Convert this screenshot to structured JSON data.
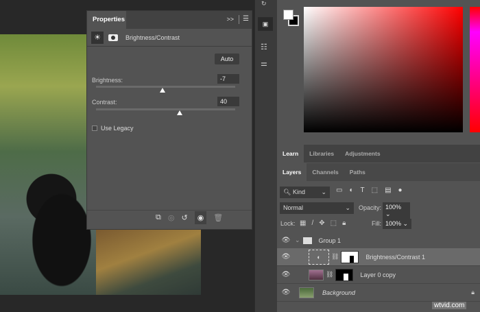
{
  "properties": {
    "tab": "Properties",
    "collapse": ">>",
    "adjustment_name": "Brightness/Contrast",
    "auto_label": "Auto",
    "brightness_label": "Brightness:",
    "brightness_value": "-7",
    "brightness_min": -150,
    "brightness_max": 150,
    "contrast_label": "Contrast:",
    "contrast_value": "40",
    "contrast_min": -50,
    "contrast_max": 100,
    "use_legacy_label": "Use Legacy",
    "use_legacy_checked": false
  },
  "panels": {
    "top_tabs": [
      "Learn",
      "Libraries",
      "Adjustments"
    ],
    "layer_tabs": [
      "Layers",
      "Channels",
      "Paths"
    ]
  },
  "layers": {
    "filter_kind": "Kind",
    "blend_mode": "Normal",
    "opacity_label": "Opacity:",
    "opacity_value": "100%",
    "lock_label": "Lock:",
    "fill_label": "Fill:",
    "fill_value": "100%",
    "items": [
      {
        "name": "Group 1"
      },
      {
        "name": "Brightness/Contrast 1"
      },
      {
        "name": "Layer 0 copy"
      },
      {
        "name": "Background"
      }
    ]
  },
  "watermark": "wtvid.com"
}
